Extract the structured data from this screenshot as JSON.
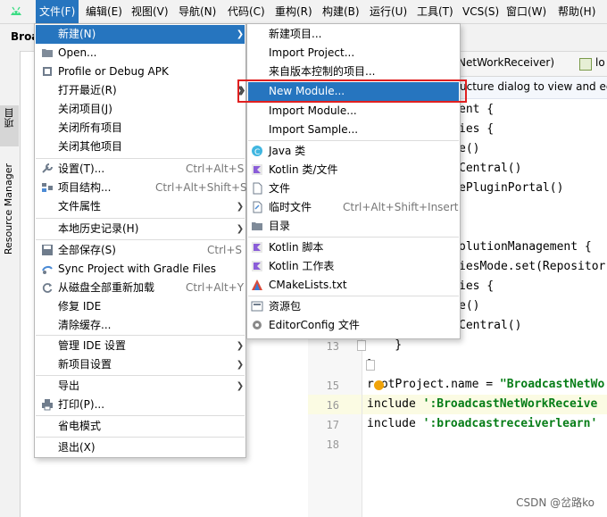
{
  "menubar": {
    "items": [
      "文件(F)",
      "编辑(E)",
      "视图(V)",
      "导航(N)",
      "代码(C)",
      "重构(R)",
      "构建(B)",
      "运行(U)",
      "工具(T)",
      "VCS(S)",
      "窗口(W)",
      "帮助(H)"
    ]
  },
  "project_name": "Broa",
  "left_stripe": {
    "project": "项目",
    "resource_manager": "Resource Manager"
  },
  "editor": {
    "tabs": [
      "NetWorkReceiver)",
      "lo"
    ],
    "notice": "ucture dialog to view and ed",
    "lines": [
      {
        "no": "13",
        "text": "    }"
      },
      {
        "no": "",
        "text": "}"
      },
      {
        "no": "15",
        "pre": "r",
        "mid": "otProject.name = ",
        "str": "\"BroadcastNetWo"
      },
      {
        "no": "16",
        "pre": "include ",
        "str": "':BroadcastNetWorkReceive"
      },
      {
        "no": "17",
        "pre": "include ",
        "str": "':broadcastreceiverlearn'"
      },
      {
        "no": "18",
        "text": ""
      }
    ],
    "visible_code": [
      "ent {",
      "ies {",
      "e()",
      "Central()",
      "ePluginPortal()",
      "olutionManagement {",
      "iesMode.set(Repositor",
      "ies {",
      "e()",
      "Central()"
    ]
  },
  "file_menu": {
    "items": [
      {
        "label": "新建(N)",
        "arrow": true,
        "selected": true
      },
      {
        "label": "Open..."
      },
      {
        "label": "Profile or Debug APK"
      },
      {
        "label": "打开最近(R)",
        "arrow": true
      },
      {
        "label": "关闭项目(J)"
      },
      {
        "label": "关闭所有项目"
      },
      {
        "label": "关闭其他项目"
      },
      {
        "label": "设置(T)...",
        "shortcut": "Ctrl+Alt+S"
      },
      {
        "label": "项目结构...",
        "shortcut": "Ctrl+Alt+Shift+S"
      },
      {
        "label": "文件属性",
        "arrow": true
      },
      {
        "label": "本地历史记录(H)",
        "arrow": true
      },
      {
        "label": "全部保存(S)",
        "shortcut": "Ctrl+S"
      },
      {
        "label": "Sync Project with Gradle Files"
      },
      {
        "label": "从磁盘全部重新加载",
        "shortcut": "Ctrl+Alt+Y"
      },
      {
        "label": "修复 IDE"
      },
      {
        "label": "清除缓存..."
      },
      {
        "label": "管理 IDE 设置",
        "arrow": true
      },
      {
        "label": "新项目设置",
        "arrow": true
      },
      {
        "label": "导出",
        "arrow": true
      },
      {
        "label": "打印(P)..."
      },
      {
        "label": "省电模式"
      },
      {
        "label": "退出(X)"
      }
    ]
  },
  "new_menu": {
    "items": [
      {
        "label": "新建项目..."
      },
      {
        "label": "Import Project..."
      },
      {
        "label": "来自版本控制的项目..."
      },
      {
        "label": "New Module...",
        "selected": true
      },
      {
        "label": "Import Module..."
      },
      {
        "label": "Import Sample..."
      },
      {
        "label": "Java 类"
      },
      {
        "label": "Kotlin 类/文件"
      },
      {
        "label": "文件"
      },
      {
        "label": "临时文件",
        "shortcut": "Ctrl+Alt+Shift+Insert"
      },
      {
        "label": "目录"
      },
      {
        "label": "Kotlin 脚本"
      },
      {
        "label": "Kotlin 工作表"
      },
      {
        "label": "CMakeLists.txt"
      },
      {
        "label": "资源包"
      },
      {
        "label": "EditorConfig 文件"
      }
    ]
  },
  "watermark": "CSDN @岔路ko",
  "colors": {
    "accent": "#2675bf",
    "highlight_box": "#e02020",
    "string": "#067d17"
  }
}
